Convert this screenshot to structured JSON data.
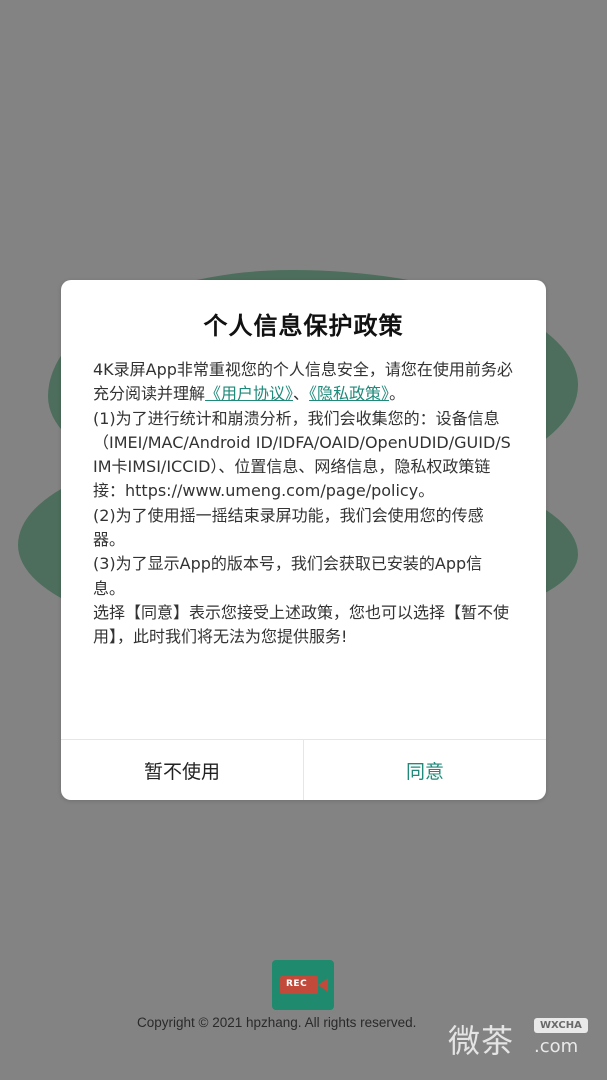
{
  "colors": {
    "overlay": "#838383",
    "splash_shape": "#4d6e5c",
    "accent": "#1f8a7a",
    "logo_background": "#1f8a6e",
    "logo_camera": "#c24a3a"
  },
  "dialog": {
    "title": "个人信息保护政策",
    "intro": {
      "prefix": "4K录屏App非常重视您的个人信息安全，请您在使用前务必充分阅读并理解",
      "link_user_agreement": "《用户协议》",
      "separator": "、",
      "link_privacy_policy": "《隐私政策》",
      "suffix": "。"
    },
    "items": [
      "(1)为了进行统计和崩溃分析，我们会收集您的：设备信息（IMEI/MAC/Android ID/IDFA/OAID/OpenUDID/GUID/SIM卡IMSI/ICCID）、位置信息、网络信息，隐私权政策链接：https://www.umeng.com/page/policy。",
      "(2)为了使用摇一摇结束录屏功能，我们会使用您的传感器。",
      "(3)为了显示App的版本号，我们会获取已安装的App信息。",
      "选择【同意】表示您接受上述政策，您也可以选择【暂不使用】，此时我们将无法为您提供服务!"
    ],
    "decline_label": "暂不使用",
    "agree_label": "同意"
  },
  "background": {
    "logo_text": "REC",
    "logo_icon": "screen-recorder-camera-icon",
    "copyright": "Copyright © 2021 hpzhang. All rights reserved.",
    "watermark_cn": "微茶",
    "watermark_tag": "WXCHA",
    "watermark_domain": ".com"
  }
}
